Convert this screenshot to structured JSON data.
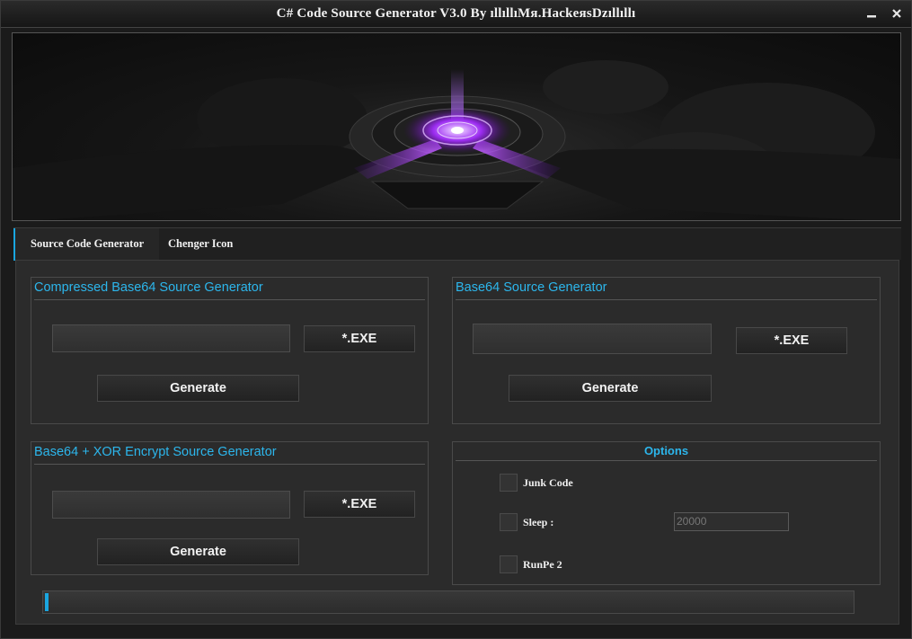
{
  "window": {
    "title": "C# Code Source Generator V3.0 By ıllıllıMя.HackeяsDzıllıllı",
    "minimize_glyph": "▬",
    "close_glyph": "✖"
  },
  "banner": {
    "icon": "glowing-reactor-core"
  },
  "tabs": [
    {
      "label": "Source Code Generator",
      "active": true
    },
    {
      "label": "Chenger Icon",
      "active": false
    }
  ],
  "groups": {
    "compressed": {
      "title": "Compressed Base64 Source  Generator",
      "file_value": "",
      "browse_label": "*.EXE",
      "generate_label": "Generate"
    },
    "base64": {
      "title": "Base64  Source  Generator",
      "file_value": "",
      "browse_label": "*.EXE",
      "generate_label": "Generate"
    },
    "xor": {
      "title": "Base64 + XOR Encrypt Source  Generator",
      "file_value": "",
      "browse_label": "*.EXE",
      "generate_label": "Generate"
    },
    "options": {
      "title": "Options",
      "junk_label": "Junk  Code",
      "junk_checked": false,
      "sleep_label": "Sleep :",
      "sleep_checked": false,
      "sleep_value": "20000",
      "runpe_label": "RunPe 2",
      "runpe_checked": false
    }
  },
  "progress": {
    "value": 0.005
  },
  "colors": {
    "accent": "#1aa6e0",
    "background": "#2b2b2b",
    "text": "#f2f2f2"
  }
}
